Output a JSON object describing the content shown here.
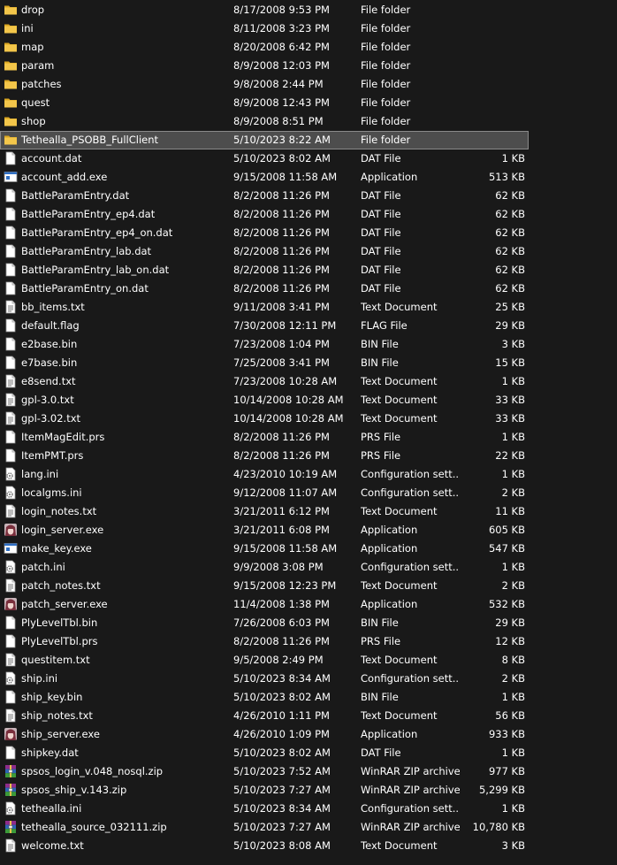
{
  "files": [
    {
      "name": "drop",
      "date": "8/17/2008 9:53 PM",
      "type": "File folder",
      "size": "",
      "icon": "folder-icon"
    },
    {
      "name": "ini",
      "date": "8/11/2008 3:23 PM",
      "type": "File folder",
      "size": "",
      "icon": "folder-icon"
    },
    {
      "name": "map",
      "date": "8/20/2008 6:42 PM",
      "type": "File folder",
      "size": "",
      "icon": "folder-icon"
    },
    {
      "name": "param",
      "date": "8/9/2008 12:03 PM",
      "type": "File folder",
      "size": "",
      "icon": "folder-icon"
    },
    {
      "name": "patches",
      "date": "9/8/2008 2:44 PM",
      "type": "File folder",
      "size": "",
      "icon": "folder-icon"
    },
    {
      "name": "quest",
      "date": "8/9/2008 12:43 PM",
      "type": "File folder",
      "size": "",
      "icon": "folder-icon"
    },
    {
      "name": "shop",
      "date": "8/9/2008 8:51 PM",
      "type": "File folder",
      "size": "",
      "icon": "folder-icon"
    },
    {
      "name": "Tethealla_PSOBB_FullClient",
      "date": "5/10/2023 8:22 AM",
      "type": "File folder",
      "size": "",
      "icon": "folder-icon",
      "selected": true
    },
    {
      "name": "account.dat",
      "date": "5/10/2023 8:02 AM",
      "type": "DAT File",
      "size": "1 KB",
      "icon": "document-icon"
    },
    {
      "name": "account_add.exe",
      "date": "9/15/2008 11:58 AM",
      "type": "Application",
      "size": "513 KB",
      "icon": "application-icon"
    },
    {
      "name": "BattleParamEntry.dat",
      "date": "8/2/2008 11:26 PM",
      "type": "DAT File",
      "size": "62 KB",
      "icon": "document-icon"
    },
    {
      "name": "BattleParamEntry_ep4.dat",
      "date": "8/2/2008 11:26 PM",
      "type": "DAT File",
      "size": "62 KB",
      "icon": "document-icon"
    },
    {
      "name": "BattleParamEntry_ep4_on.dat",
      "date": "8/2/2008 11:26 PM",
      "type": "DAT File",
      "size": "62 KB",
      "icon": "document-icon"
    },
    {
      "name": "BattleParamEntry_lab.dat",
      "date": "8/2/2008 11:26 PM",
      "type": "DAT File",
      "size": "62 KB",
      "icon": "document-icon"
    },
    {
      "name": "BattleParamEntry_lab_on.dat",
      "date": "8/2/2008 11:26 PM",
      "type": "DAT File",
      "size": "62 KB",
      "icon": "document-icon"
    },
    {
      "name": "BattleParamEntry_on.dat",
      "date": "8/2/2008 11:26 PM",
      "type": "DAT File",
      "size": "62 KB",
      "icon": "document-icon"
    },
    {
      "name": "bb_items.txt",
      "date": "9/11/2008 3:41 PM",
      "type": "Text Document",
      "size": "25 KB",
      "icon": "text-document-icon"
    },
    {
      "name": "default.flag",
      "date": "7/30/2008 12:11 PM",
      "type": "FLAG File",
      "size": "29 KB",
      "icon": "document-icon"
    },
    {
      "name": "e2base.bin",
      "date": "7/23/2008 1:04 PM",
      "type": "BIN File",
      "size": "3 KB",
      "icon": "document-icon"
    },
    {
      "name": "e7base.bin",
      "date": "7/25/2008 3:41 PM",
      "type": "BIN File",
      "size": "15 KB",
      "icon": "document-icon"
    },
    {
      "name": "e8send.txt",
      "date": "7/23/2008 10:28 AM",
      "type": "Text Document",
      "size": "1 KB",
      "icon": "text-document-icon"
    },
    {
      "name": "gpl-3.0.txt",
      "date": "10/14/2008 10:28 AM",
      "type": "Text Document",
      "size": "33 KB",
      "icon": "text-document-icon"
    },
    {
      "name": "gpl-3.02.txt",
      "date": "10/14/2008 10:28 AM",
      "type": "Text Document",
      "size": "33 KB",
      "icon": "text-document-icon"
    },
    {
      "name": "ItemMagEdit.prs",
      "date": "8/2/2008 11:26 PM",
      "type": "PRS File",
      "size": "1 KB",
      "icon": "document-icon"
    },
    {
      "name": "ItemPMT.prs",
      "date": "8/2/2008 11:26 PM",
      "type": "PRS File",
      "size": "22 KB",
      "icon": "document-icon"
    },
    {
      "name": "lang.ini",
      "date": "4/23/2010 10:19 AM",
      "type": "Configuration sett...",
      "size": "1 KB",
      "icon": "settings-file-icon"
    },
    {
      "name": "localgms.ini",
      "date": "9/12/2008 11:07 AM",
      "type": "Configuration sett...",
      "size": "2 KB",
      "icon": "settings-file-icon"
    },
    {
      "name": "login_notes.txt",
      "date": "3/21/2011 6:12 PM",
      "type": "Text Document",
      "size": "11 KB",
      "icon": "text-document-icon"
    },
    {
      "name": "login_server.exe",
      "date": "3/21/2011 6:08 PM",
      "type": "Application",
      "size": "605 KB",
      "icon": "anime-app-icon"
    },
    {
      "name": "make_key.exe",
      "date": "9/15/2008 11:58 AM",
      "type": "Application",
      "size": "547 KB",
      "icon": "application-icon"
    },
    {
      "name": "patch.ini",
      "date": "9/9/2008 3:08 PM",
      "type": "Configuration sett...",
      "size": "1 KB",
      "icon": "settings-file-icon"
    },
    {
      "name": "patch_notes.txt",
      "date": "9/15/2008 12:23 PM",
      "type": "Text Document",
      "size": "2 KB",
      "icon": "text-document-icon"
    },
    {
      "name": "patch_server.exe",
      "date": "11/4/2008 1:38 PM",
      "type": "Application",
      "size": "532 KB",
      "icon": "anime-app-icon"
    },
    {
      "name": "PlyLevelTbl.bin",
      "date": "7/26/2008 6:03 PM",
      "type": "BIN File",
      "size": "29 KB",
      "icon": "document-icon"
    },
    {
      "name": "PlyLevelTbl.prs",
      "date": "8/2/2008 11:26 PM",
      "type": "PRS File",
      "size": "12 KB",
      "icon": "document-icon"
    },
    {
      "name": "questitem.txt",
      "date": "9/5/2008 2:49 PM",
      "type": "Text Document",
      "size": "8 KB",
      "icon": "text-document-icon"
    },
    {
      "name": "ship.ini",
      "date": "5/10/2023 8:34 AM",
      "type": "Configuration sett...",
      "size": "2 KB",
      "icon": "settings-file-icon"
    },
    {
      "name": "ship_key.bin",
      "date": "5/10/2023 8:02 AM",
      "type": "BIN File",
      "size": "1 KB",
      "icon": "document-icon"
    },
    {
      "name": "ship_notes.txt",
      "date": "4/26/2010 1:11 PM",
      "type": "Text Document",
      "size": "56 KB",
      "icon": "text-document-icon"
    },
    {
      "name": "ship_server.exe",
      "date": "4/26/2010 1:09 PM",
      "type": "Application",
      "size": "933 KB",
      "icon": "anime-app-icon"
    },
    {
      "name": "shipkey.dat",
      "date": "5/10/2023 8:02 AM",
      "type": "DAT File",
      "size": "1 KB",
      "icon": "document-icon"
    },
    {
      "name": "spsos_login_v.048_nosql.zip",
      "date": "5/10/2023 7:52 AM",
      "type": "WinRAR ZIP archive",
      "size": "977 KB",
      "icon": "winrar-archive-icon"
    },
    {
      "name": "spsos_ship_v.143.zip",
      "date": "5/10/2023 7:27 AM",
      "type": "WinRAR ZIP archive",
      "size": "5,299 KB",
      "icon": "winrar-archive-icon"
    },
    {
      "name": "tethealla.ini",
      "date": "5/10/2023 8:34 AM",
      "type": "Configuration sett...",
      "size": "1 KB",
      "icon": "settings-file-icon"
    },
    {
      "name": "tethealla_source_032111.zip",
      "date": "5/10/2023 7:27 AM",
      "type": "WinRAR ZIP archive",
      "size": "10,780 KB",
      "icon": "winrar-archive-icon"
    },
    {
      "name": "welcome.txt",
      "date": "5/10/2023 8:08 AM",
      "type": "Text Document",
      "size": "3 KB",
      "icon": "text-document-icon"
    }
  ],
  "colors": {
    "background": "#191919",
    "text": "#ffffff",
    "selected_row": "#4d4d4d",
    "selected_border": "#8a8a8a",
    "folder": "#f0c040"
  }
}
